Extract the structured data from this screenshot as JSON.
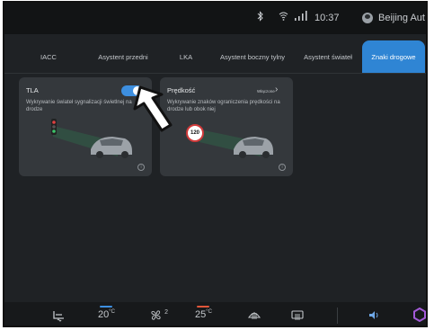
{
  "status": {
    "bluetooth_icon": "bluetooth-icon",
    "wifi_icon": "wifi-icon",
    "signal_icon": "signal-icon",
    "time": "10:37",
    "user": "Beijing Aut"
  },
  "tabs": [
    {
      "label": "IACC",
      "active": false
    },
    {
      "label": "Asystent przedni",
      "active": false
    },
    {
      "label": "LKA",
      "active": false
    },
    {
      "label": "Asystent boczny tylny",
      "active": false
    },
    {
      "label": "Asystent świateł",
      "active": false
    },
    {
      "label": "Znaki drogowe",
      "active": true
    }
  ],
  "cards": {
    "tla": {
      "title": "TLA",
      "description": "Wykrywanie świateł sygnalizacji świetlnej na drodze",
      "toggle_on": true
    },
    "speed": {
      "title": "Prędkość",
      "status": "Włączone",
      "description": "Wykrywanie znaków ograniczenia prędkości na drodze lub obok niej",
      "sign_value": "120"
    }
  },
  "bottom_bar": {
    "temp_left": "20",
    "fan_level": "2",
    "temp_right": "25",
    "temp_unit": "°C",
    "colors": {
      "left_temp_line": "#3d8fe0",
      "right_temp_line": "#e0563a",
      "accent": "#2f85d4"
    }
  }
}
